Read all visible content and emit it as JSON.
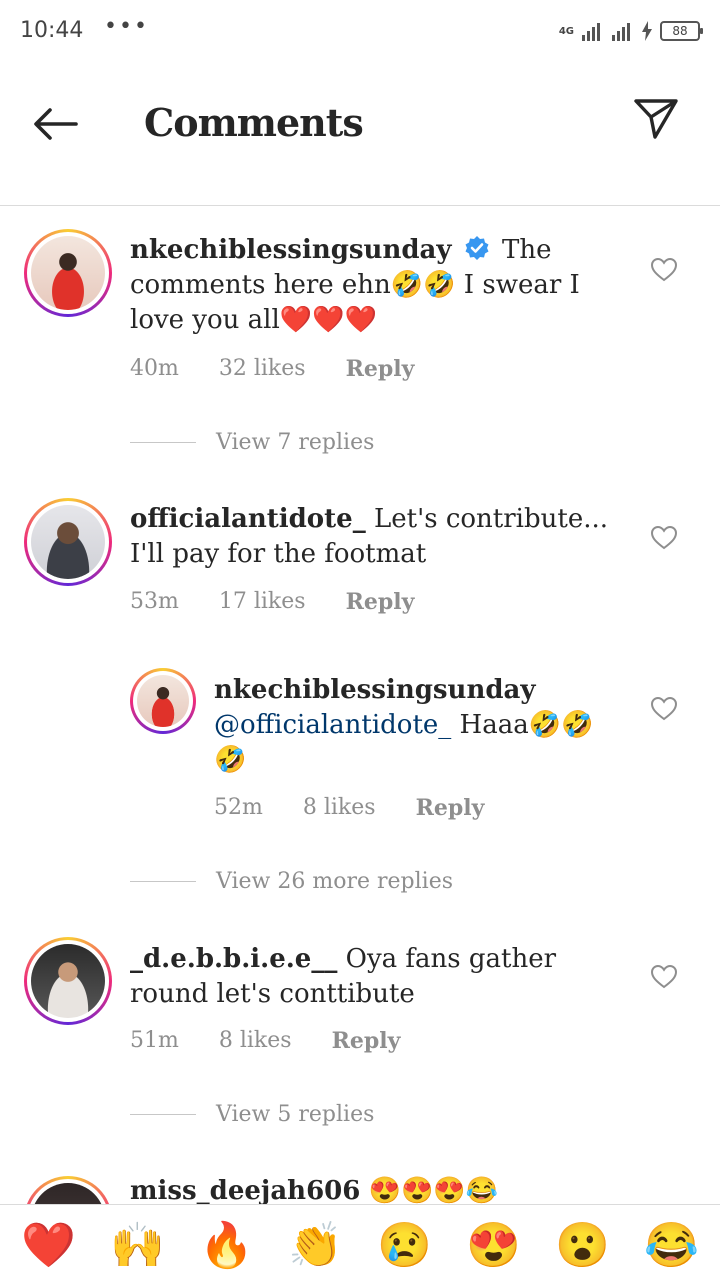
{
  "status": {
    "time": "10:44",
    "dots": "•••",
    "network": "4G",
    "battery": "88"
  },
  "header": {
    "title": "Comments"
  },
  "comments": [
    {
      "username": "nkechiblessingsunday",
      "verified": true,
      "text": "The comments here ehn🤣🤣 I swear I love you all❤️❤️❤️",
      "time": "40m",
      "likes": "32 likes",
      "reply": "Reply",
      "view_replies": "View 7 replies"
    },
    {
      "username": "officialantidote_",
      "text": "Let's contribute... I'll pay for the footmat",
      "time": "53m",
      "likes": "17 likes",
      "reply": "Reply"
    },
    {
      "username": "nkechiblessingsunday",
      "mention": "@officialantidote_",
      "text": "Haaa🤣🤣🤣",
      "time": "52m",
      "likes": "8 likes",
      "reply": "Reply",
      "view_replies": "View 26 more replies"
    },
    {
      "username": "_d.e.b.b.i.e.e__",
      "text": "Oya fans gather round let's conttibute",
      "time": "51m",
      "likes": "8 likes",
      "reply": "Reply",
      "view_replies": "View 5 replies"
    },
    {
      "username": "miss_deejah606",
      "text": "😍😍😍😂"
    }
  ],
  "reactions": [
    "❤️",
    "🙌",
    "🔥",
    "👏",
    "😢",
    "😍",
    "😮",
    "😂"
  ],
  "colors": {
    "verified_blue": "#3897f0",
    "mention_blue": "#00376b",
    "secondary_text": "#8e8e8e"
  },
  "icons": {
    "back": "back-arrow-icon",
    "send": "direct-send-icon",
    "like": "heart-outline-icon",
    "verified": "verified-badge-icon"
  }
}
